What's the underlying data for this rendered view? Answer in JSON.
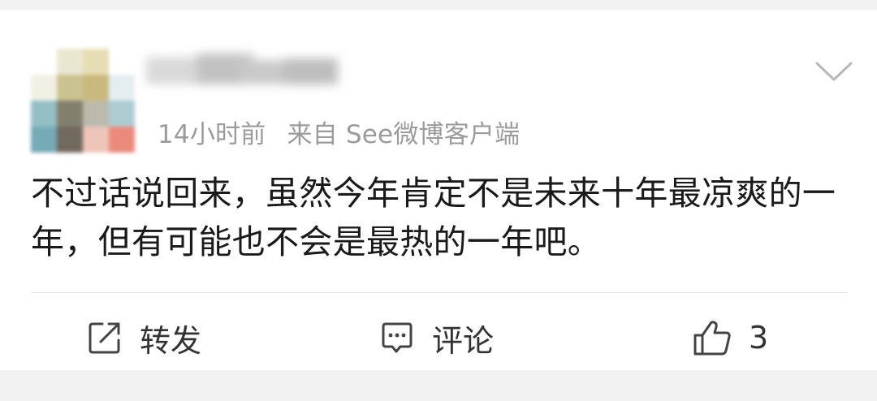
{
  "post": {
    "time": "14小时前",
    "source": "来自 See微博客户端",
    "content": "不过话说回来，虽然今年肯定不是未来十年最凉爽的一年，但有可能也不会是最热的一年吧。"
  },
  "actions": {
    "repost_label": "转发",
    "comment_label": "评论",
    "like_count": "3"
  },
  "icons": {
    "repost": "edit-share-icon",
    "comment": "comment-bubble-icon",
    "like": "thumbs-up-icon",
    "menu": "chevron-down-icon"
  },
  "colors": {
    "text_primary": "#1a1a1a",
    "text_meta": "#9b9b9b",
    "page_background": "#f2f2f2",
    "card_background": "#ffffff"
  }
}
